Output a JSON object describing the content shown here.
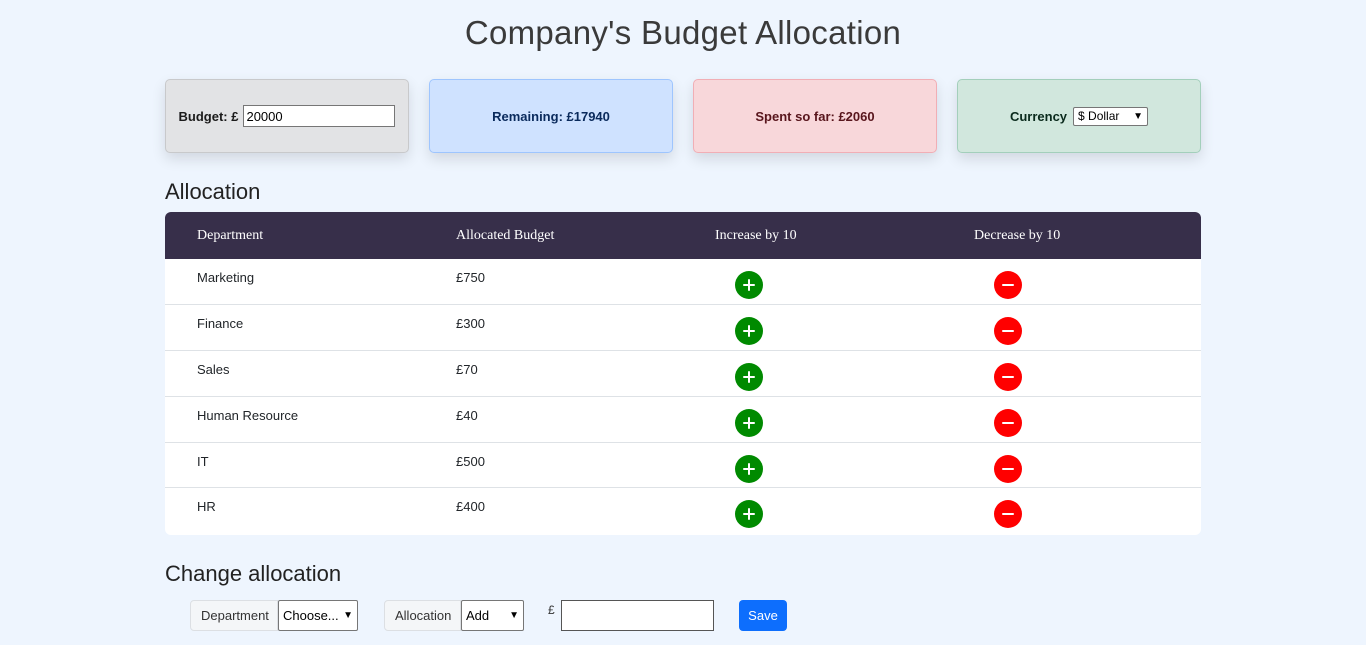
{
  "title": "Company's Budget Allocation",
  "cards": {
    "budget_label": "Budget: £",
    "budget_value": "20000",
    "remaining": "Remaining: £17940",
    "spent": "Spent so far: £2060",
    "currency_label": "Currency",
    "currency_selected": "$ Dollar"
  },
  "allocation": {
    "heading": "Allocation",
    "columns": [
      "Department",
      "Allocated Budget",
      "Increase by 10",
      "Decrease by 10"
    ],
    "rows": [
      {
        "department": "Marketing",
        "budget": "£750"
      },
      {
        "department": "Finance",
        "budget": "£300"
      },
      {
        "department": "Sales",
        "budget": "£70"
      },
      {
        "department": "Human Resource",
        "budget": "£40"
      },
      {
        "department": "IT",
        "budget": "£500"
      },
      {
        "department": "HR",
        "budget": "£400"
      }
    ],
    "icons": {
      "increase": "plus-circle-icon",
      "decrease": "minus-circle-icon"
    },
    "colors": {
      "header_bg": "#372f4a",
      "increase": "#008a00",
      "decrease": "#ff0000"
    }
  },
  "change": {
    "heading": "Change allocation",
    "department_label": "Department",
    "department_selected": "Choose...",
    "allocation_label": "Allocation",
    "allocation_selected": "Add",
    "currency_symbol": "£",
    "amount_value": "",
    "save_label": "Save"
  }
}
